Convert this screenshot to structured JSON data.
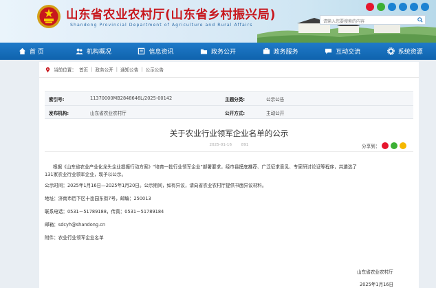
{
  "site": {
    "title": "山东省农业农村厅(山东省乡村振兴局)",
    "subtitle": "Shandong Provincial Department of Agriculture and Rural Affairs",
    "search_placeholder": "请输入您要搜索的内容"
  },
  "nav": [
    {
      "label": "首 页",
      "icon": "home-icon"
    },
    {
      "label": "机构概况",
      "icon": "people-icon"
    },
    {
      "label": "信息资讯",
      "icon": "news-icon"
    },
    {
      "label": "政务公开",
      "icon": "folder-icon"
    },
    {
      "label": "政务服务",
      "icon": "service-icon"
    },
    {
      "label": "互动交流",
      "icon": "chat-icon"
    },
    {
      "label": "系统资源",
      "icon": "gear-icon"
    }
  ],
  "breadcrumb": {
    "prefix": "当前位置：",
    "items": [
      "首页",
      "政务公开",
      "通知公告",
      "公示公告"
    ],
    "separator": "|"
  },
  "meta": {
    "index_label": "索引号:",
    "index_value": "11370000MB2848646L/2025-00142",
    "category_label": "主题分类:",
    "category_value": "公示公告",
    "publisher_label": "发布机构:",
    "publisher_value": "山东省农业农村厅",
    "mode_label": "公开方式:",
    "mode_value": "主动公开"
  },
  "article": {
    "title": "关于农业行业领军企业名单的公示",
    "date": "2025-01-16",
    "views": "891",
    "share_label": "分享到：",
    "paragraphs": [
      "根据《山东省农业产业化龙头企业提振行动方案》“培育一批行业领军企业”部署要求，经市县摸底推荐、广泛征求意见、专家研讨论证等程序，共遴选了",
      "131家农业行业领军企业，现予以公示。",
      "公示时间：2025年1月16日—2025年1月20日。公示期间，如有异议，请向省农业农村厅提供书面异议材料。",
      "地址：济南市历下区十亩园东街7号，邮编：250013",
      "联系电话：0531－51789188，传真：0531－51789184",
      "邮箱：sdcyh@shandong.cn",
      "附件：农业行业领军企业名单"
    ],
    "signer": "山东省农业农村厅",
    "sign_date": "2025年1月16日"
  },
  "colors": {
    "brand_red": "#c8171d",
    "nav_blue": "#1570bd",
    "weibo": "#e6162d",
    "wechat": "#3cb034",
    "qzone": "#f5b800"
  }
}
